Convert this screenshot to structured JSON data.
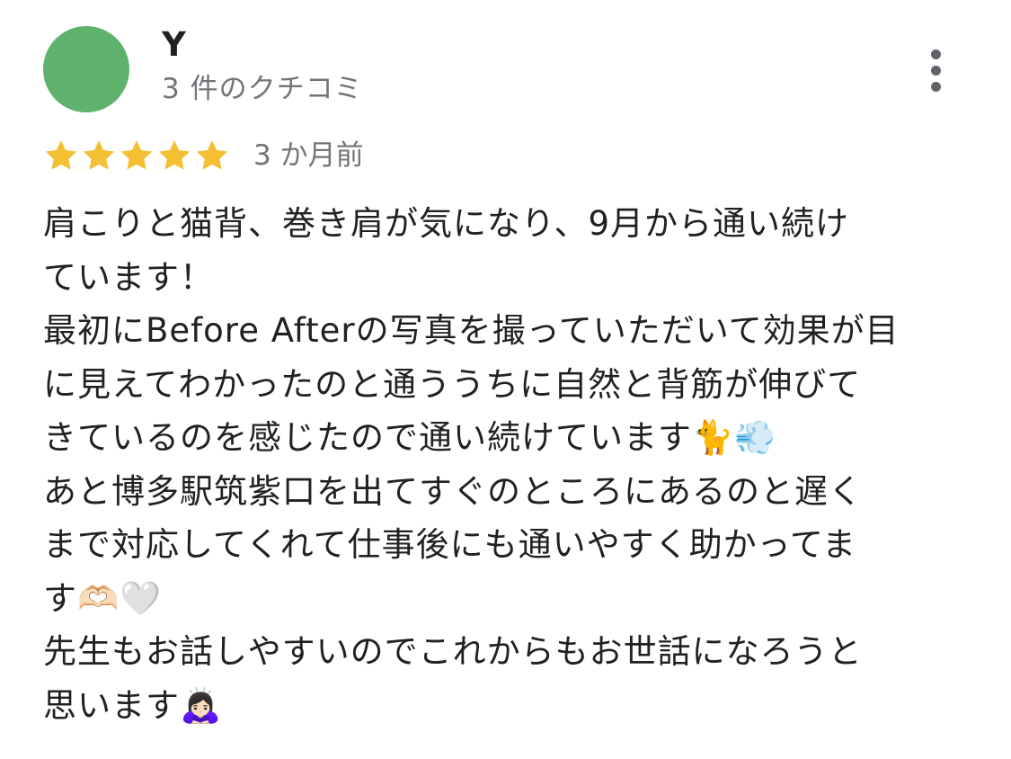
{
  "reviewer": {
    "name": "Y",
    "review_count": "3 件のクチコミ",
    "avatar_color": "#5fb26e"
  },
  "rating": {
    "stars": 5,
    "max_stars": 5,
    "star_color": "#f4c033",
    "date": "3 か月前"
  },
  "menu": {
    "icon": "more-vertical-icon"
  },
  "review": {
    "lines": [
      "肩こりと猫背、巻き肩が気になり、9月から通い続け",
      "ています！",
      "最初にBefore Afterの写真を撮っていただいて効果が目",
      "に見えてわかったのと通ううちに自然と背筋が伸びて",
      "きているのを感じたので通い続けています🐈💨",
      "あと博多駅筑紫口を出てすぐのところにあるのと遅く",
      "まで対応してくれて仕事後にも通いやすく助かってま",
      "す🫶🏻🤍",
      "先生もお話しやすいのでこれからもお世話になろうと",
      "思います🙇🏻‍♀️"
    ]
  }
}
